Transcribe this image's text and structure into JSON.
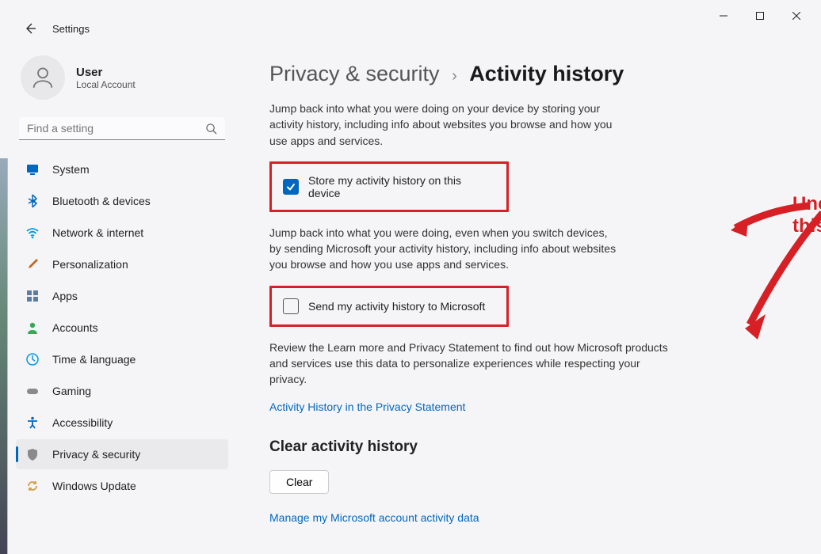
{
  "window": {
    "app_title": "Settings",
    "icons": {
      "minimize": "minimize-icon",
      "maximize": "maximize-icon",
      "close": "close-icon"
    }
  },
  "user": {
    "name": "User",
    "sub": "Local Account"
  },
  "search": {
    "placeholder": "Find a setting"
  },
  "sidebar": {
    "items": [
      {
        "label": "System",
        "icon": "display-icon",
        "color": "#0067c0"
      },
      {
        "label": "Bluetooth & devices",
        "icon": "bluetooth-icon",
        "color": "#0067c0"
      },
      {
        "label": "Network & internet",
        "icon": "wifi-icon",
        "color": "#0099e5"
      },
      {
        "label": "Personalization",
        "icon": "brush-icon",
        "color": "#c06a2a"
      },
      {
        "label": "Apps",
        "icon": "apps-icon",
        "color": "#5a7da0"
      },
      {
        "label": "Accounts",
        "icon": "person-icon",
        "color": "#3aa757"
      },
      {
        "label": "Time & language",
        "icon": "clock-globe-icon",
        "color": "#0099e5"
      },
      {
        "label": "Gaming",
        "icon": "gamepad-icon",
        "color": "#8a8a8a"
      },
      {
        "label": "Accessibility",
        "icon": "accessibility-icon",
        "color": "#0067c0"
      },
      {
        "label": "Privacy & security",
        "icon": "shield-icon",
        "color": "#8a8a8a",
        "active": true
      },
      {
        "label": "Windows Update",
        "icon": "update-icon",
        "color": "#d89b3e"
      }
    ]
  },
  "breadcrumb": {
    "parent": "Privacy & security",
    "current": "Activity history"
  },
  "content": {
    "desc1": "Jump back into what you were doing on your device by storing your activity history, including info about websites you browse and how you use apps and services.",
    "cb1_label": "Store my activity history on this device",
    "cb1_checked": true,
    "desc2": "Jump back into what you were doing, even when you switch devices, by sending Microsoft your activity history, including info about websites you browse and how you use apps and services.",
    "cb2_label": "Send my activity history to Microsoft",
    "cb2_checked": false,
    "desc3": "Review the Learn more and Privacy Statement to find out how Microsoft products and services use this data to personalize experiences while respecting your privacy.",
    "link1": "Activity History in the Privacy Statement",
    "section_clear_title": "Clear activity history",
    "clear_button": "Clear",
    "link2": "Manage my Microsoft account activity data"
  },
  "annotation": {
    "text": "Uncheck this"
  }
}
